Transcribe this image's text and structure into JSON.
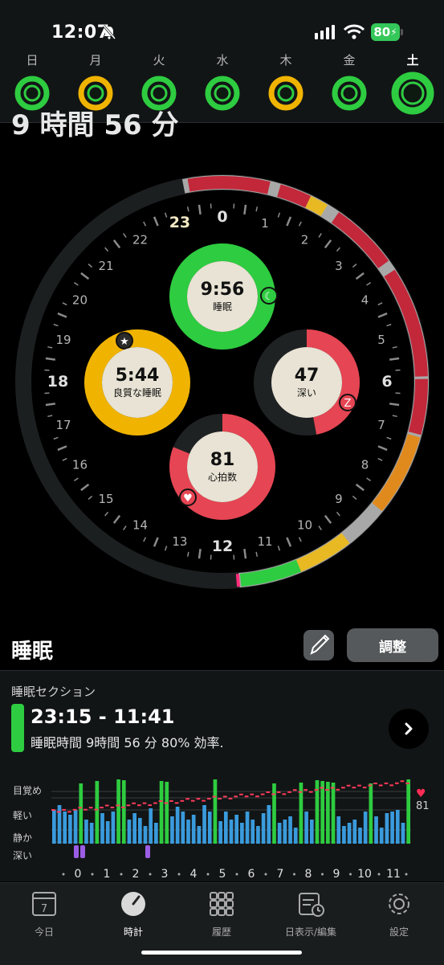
{
  "status": {
    "time": "12:07",
    "battery": "80"
  },
  "week": [
    {
      "label": "日",
      "color": "#2ecc40",
      "selected": false
    },
    {
      "label": "月",
      "color": "#f0b400",
      "selected": false
    },
    {
      "label": "火",
      "color": "#2ecc40",
      "selected": false
    },
    {
      "label": "水",
      "color": "#2ecc40",
      "selected": false
    },
    {
      "label": "木",
      "color": "#f0b400",
      "selected": false
    },
    {
      "label": "金",
      "color": "#2ecc40",
      "selected": false
    },
    {
      "label": "土",
      "color": "#2ecc40",
      "selected": true
    }
  ],
  "header": {
    "title_clipped": "9 時間 56 分"
  },
  "dial": {
    "hours": [
      "0",
      "1",
      "2",
      "3",
      "4",
      "5",
      "6",
      "7",
      "8",
      "9",
      "10",
      "11",
      "12",
      "13",
      "14",
      "15",
      "16",
      "17",
      "18",
      "19",
      "20",
      "21",
      "22",
      "23"
    ],
    "rings": {
      "sleep": {
        "value": "9:56",
        "label": "睡眠",
        "color": "#2ecc40",
        "fraction": 1.0
      },
      "quality": {
        "value": "5:44",
        "label": "良質な睡眠",
        "color": "#f0b400",
        "fraction": 1.0
      },
      "deep": {
        "value": "47",
        "label": "深い",
        "color": "#e64553",
        "fraction": 0.47
      },
      "heart": {
        "value": "81",
        "label": "心拍数",
        "color": "#e64553",
        "fraction": 0.81
      }
    }
  },
  "sleep": {
    "title": "睡眠",
    "adjust_label": "調整"
  },
  "section": {
    "label": "睡眠セクション",
    "range": "23:15 - 11:41",
    "detail": "睡眠時間 9時間 56 分 80% 効率."
  },
  "graph": {
    "levels": [
      "目覚め",
      "軽い",
      "静か",
      "深い"
    ],
    "hr_value": "81",
    "hour_ticks": [
      "0",
      "1",
      "2",
      "3",
      "4",
      "5",
      "6",
      "7",
      "8",
      "9",
      "10",
      "11"
    ],
    "colors": {
      "awake": "#2ecc40",
      "light": "#3a9bdc",
      "deep": "#9b5de5",
      "hr": "#ff3b5c"
    }
  },
  "tabs": [
    {
      "label": "今日",
      "icon": "calendar-icon",
      "active": false
    },
    {
      "label": "時計",
      "icon": "clock-icon",
      "active": true
    },
    {
      "label": "履歴",
      "icon": "grid-icon",
      "active": false
    },
    {
      "label": "日表示/編集",
      "icon": "calendar-clock-icon",
      "active": false
    },
    {
      "label": "設定",
      "icon": "gear-icon",
      "active": false
    }
  ]
}
